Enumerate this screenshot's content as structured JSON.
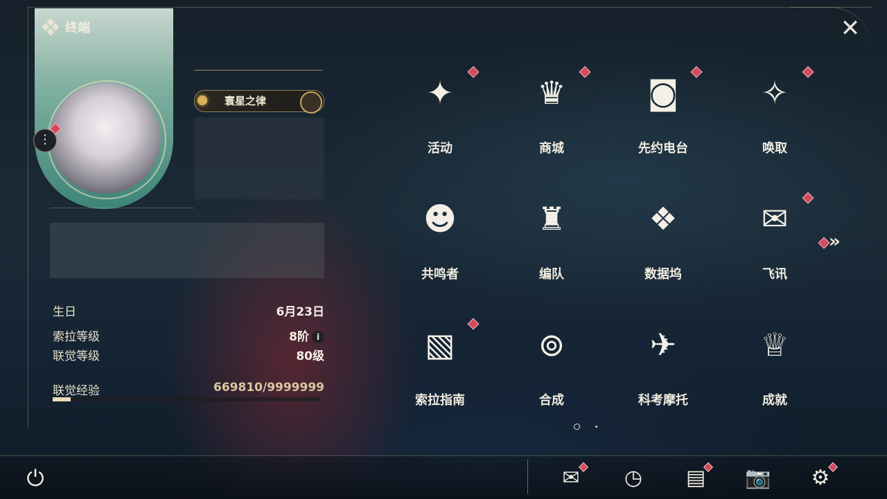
{
  "header": {
    "title": "终端"
  },
  "profile": {
    "title_badge": "寰星之律",
    "birthday_label": "生日",
    "birthday_value": "6月23日",
    "sola_level_label": "索拉等级",
    "sola_level_value": "8阶",
    "union_level_label": "联觉等级",
    "union_level_value": "80级",
    "union_exp_label": "联觉经验",
    "union_exp_value": "669810/9999999",
    "union_exp_fraction": 0.067
  },
  "grid": {
    "items": [
      {
        "label": "活动",
        "icon": "2nd-anniversary-icon",
        "badge": true
      },
      {
        "label": "商城",
        "icon": "shop-cart-icon",
        "badge": true
      },
      {
        "label": "先约电台",
        "icon": "radio-icon",
        "badge": true
      },
      {
        "label": "唤取",
        "icon": "compass-star-icon",
        "badge": true
      },
      {
        "label": "共鸣者",
        "icon": "resonator-head-icon",
        "badge": false
      },
      {
        "label": "编队",
        "icon": "chess-formation-icon",
        "badge": false
      },
      {
        "label": "数据坞",
        "icon": "data-dock-icon",
        "badge": false
      },
      {
        "label": "飞讯",
        "icon": "chat-bubble-icon",
        "badge": true
      },
      {
        "label": "索拉指南",
        "icon": "guidebook-icon",
        "badge": true
      },
      {
        "label": "合成",
        "icon": "synthesis-orbit-icon",
        "badge": false
      },
      {
        "label": "科考摩托",
        "icon": "motorbike-icon",
        "badge": false
      },
      {
        "label": "成就",
        "icon": "trophy-icon",
        "badge": false
      }
    ]
  },
  "next_page": "»",
  "close": "✕",
  "menu_dots": "⋮",
  "info_icon": "i",
  "power": "⏻",
  "bottom_icons": [
    {
      "name": "mail-icon",
      "glyph": "✉",
      "badge": true
    },
    {
      "name": "clock-icon",
      "glyph": "◷",
      "badge": false
    },
    {
      "name": "notice-icon",
      "glyph": "▤",
      "badge": true
    },
    {
      "name": "camera-icon",
      "glyph": "📷",
      "badge": false
    },
    {
      "name": "settings-gear-icon",
      "glyph": "⚙",
      "badge": true
    }
  ],
  "colors": {
    "badge": "#d24a5e",
    "accent_gold": "#d2be82"
  }
}
